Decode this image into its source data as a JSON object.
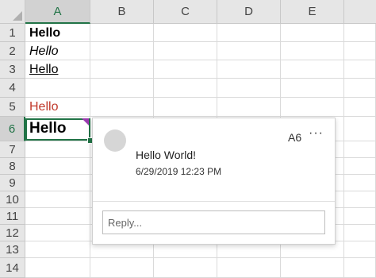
{
  "columns": [
    "A",
    "B",
    "C",
    "D",
    "E"
  ],
  "rows": [
    "1",
    "2",
    "3",
    "4",
    "5",
    "6",
    "7",
    "8",
    "9",
    "10",
    "11",
    "12",
    "13",
    "14"
  ],
  "cells": {
    "a1": "Hello",
    "a2": "Hello",
    "a3": "Hello",
    "a4": "",
    "a5": "Hello",
    "a6": "Hello"
  },
  "colors": {
    "selection": "#217346",
    "red_text": "#c0392b",
    "comment_flag": "#9b3ab0"
  },
  "comment": {
    "cell_ref": "A6",
    "more_label": "···",
    "text": "Hello World!",
    "date": "6/29/2019 12:23 PM",
    "reply_placeholder": "Reply..."
  }
}
